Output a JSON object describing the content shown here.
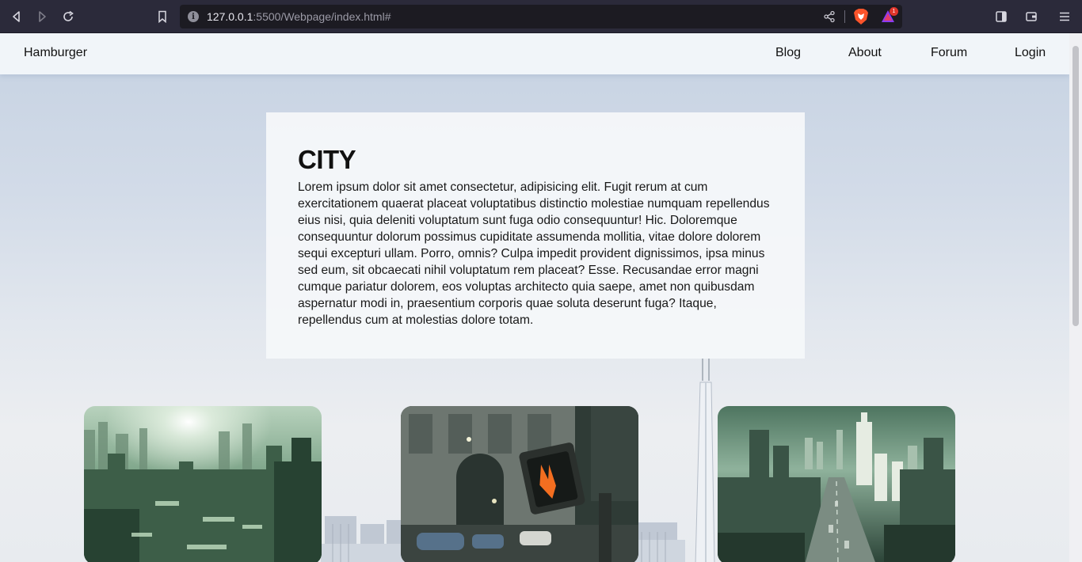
{
  "browser": {
    "url_host": "127.0.0.1",
    "url_rest": ":5500/Webpage/index.html#",
    "rewards_badge": "1",
    "icons": [
      "back-icon",
      "forward-icon",
      "reload-icon",
      "bookmark-icon",
      "site-info-icon",
      "share-icon",
      "brave-shields-icon",
      "brave-rewards-icon",
      "sidebar-icon",
      "wallet-icon",
      "menu-icon"
    ]
  },
  "navbar": {
    "brand": "Hamburger",
    "links": [
      "Blog",
      "About",
      "Forum",
      "Login"
    ]
  },
  "hero": {
    "title": "CITY",
    "body": "Lorem ipsum dolor sit amet consectetur, adipisicing elit. Fugit rerum at cum exercitationem quaerat placeat voluptatibus distinctio molestiae numquam repellendus eius nisi, quia deleniti voluptatum sunt fuga odio consequuntur! Hic. Doloremque consequuntur dolorum possimus cupiditate assumenda mollitia, vitae dolore dolorem sequi excepturi ullam. Porro, omnis? Culpa impedit provident dignissimos, ipsa minus sed eum, sit obcaecati nihil voluptatum rem placeat? Esse. Recusandae error magni cumque pariatur dolorem, eos voluptas architecto quia saepe, amet non quibusdam aspernatur modi in, praesentium corporis quae soluta deserunt fuga? Itaque, repellendus cum at molestias dolore totam."
  },
  "colors": {
    "chrome": "#2b2a3a",
    "urlbar": "#1c1b22",
    "brave_orange": "#fb542b",
    "photo_green": "#4f7d5a"
  }
}
